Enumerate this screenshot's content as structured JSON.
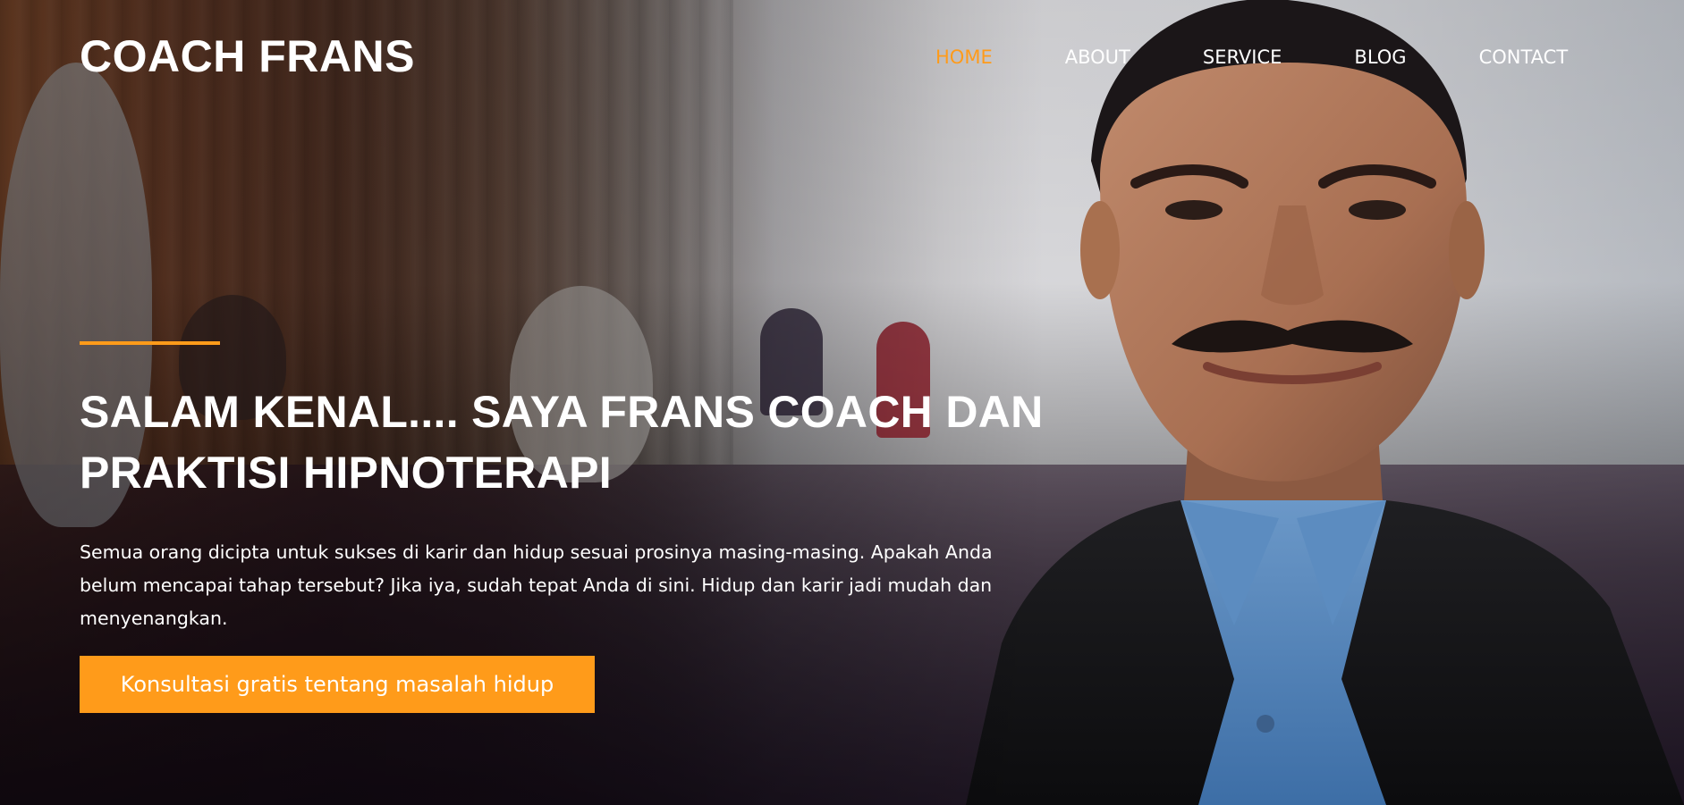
{
  "brand": {
    "logo_text": "COACH FRANS"
  },
  "nav": {
    "items": [
      {
        "label": "HOME",
        "active": true
      },
      {
        "label": "ABOUT",
        "active": false
      },
      {
        "label": "SERVICE",
        "active": false
      },
      {
        "label": "BLOG",
        "active": false
      },
      {
        "label": "CONTACT",
        "active": false
      }
    ]
  },
  "hero": {
    "headline": "SALAM KENAL.... SAYA FRANS COACH DAN PRAKTISI HIPNOTERAPI",
    "lead": "Semua orang dicipta untuk sukses di karir dan hidup sesuai prosinya masing-masing. Apakah Anda belum mencapai tahap tersebut? Jika iya, sudah tepat Anda di sini. Hidup dan karir jadi mudah dan menyenangkan.",
    "cta_label": "Konsultasi gratis tentang masalah hidup"
  },
  "colors": {
    "accent": "#ff9b1a",
    "text": "#ffffff"
  },
  "icons": {
    "hero_image": "portrait-photo"
  }
}
